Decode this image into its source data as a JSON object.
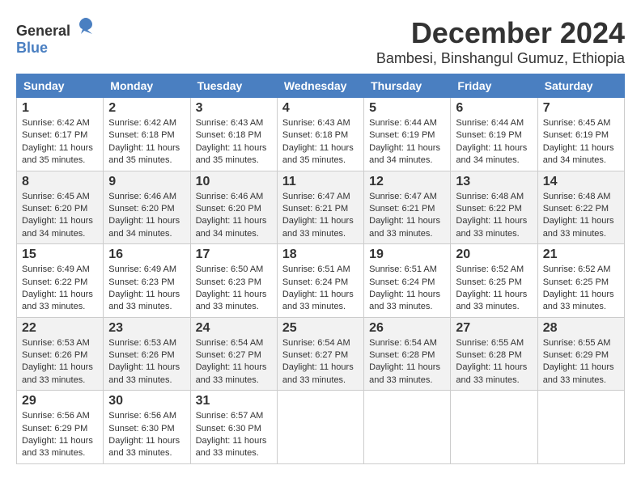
{
  "logo": {
    "general": "General",
    "blue": "Blue"
  },
  "title": "December 2024",
  "location": "Bambesi, Binshangul Gumuz, Ethiopia",
  "days_of_week": [
    "Sunday",
    "Monday",
    "Tuesday",
    "Wednesday",
    "Thursday",
    "Friday",
    "Saturday"
  ],
  "weeks": [
    [
      {
        "day": "1",
        "sunrise": "6:42 AM",
        "sunset": "6:17 PM",
        "daylight": "11 hours and 35 minutes."
      },
      {
        "day": "2",
        "sunrise": "6:42 AM",
        "sunset": "6:18 PM",
        "daylight": "11 hours and 35 minutes."
      },
      {
        "day": "3",
        "sunrise": "6:43 AM",
        "sunset": "6:18 PM",
        "daylight": "11 hours and 35 minutes."
      },
      {
        "day": "4",
        "sunrise": "6:43 AM",
        "sunset": "6:18 PM",
        "daylight": "11 hours and 35 minutes."
      },
      {
        "day": "5",
        "sunrise": "6:44 AM",
        "sunset": "6:19 PM",
        "daylight": "11 hours and 34 minutes."
      },
      {
        "day": "6",
        "sunrise": "6:44 AM",
        "sunset": "6:19 PM",
        "daylight": "11 hours and 34 minutes."
      },
      {
        "day": "7",
        "sunrise": "6:45 AM",
        "sunset": "6:19 PM",
        "daylight": "11 hours and 34 minutes."
      }
    ],
    [
      {
        "day": "8",
        "sunrise": "6:45 AM",
        "sunset": "6:20 PM",
        "daylight": "11 hours and 34 minutes."
      },
      {
        "day": "9",
        "sunrise": "6:46 AM",
        "sunset": "6:20 PM",
        "daylight": "11 hours and 34 minutes."
      },
      {
        "day": "10",
        "sunrise": "6:46 AM",
        "sunset": "6:20 PM",
        "daylight": "11 hours and 34 minutes."
      },
      {
        "day": "11",
        "sunrise": "6:47 AM",
        "sunset": "6:21 PM",
        "daylight": "11 hours and 33 minutes."
      },
      {
        "day": "12",
        "sunrise": "6:47 AM",
        "sunset": "6:21 PM",
        "daylight": "11 hours and 33 minutes."
      },
      {
        "day": "13",
        "sunrise": "6:48 AM",
        "sunset": "6:22 PM",
        "daylight": "11 hours and 33 minutes."
      },
      {
        "day": "14",
        "sunrise": "6:48 AM",
        "sunset": "6:22 PM",
        "daylight": "11 hours and 33 minutes."
      }
    ],
    [
      {
        "day": "15",
        "sunrise": "6:49 AM",
        "sunset": "6:22 PM",
        "daylight": "11 hours and 33 minutes."
      },
      {
        "day": "16",
        "sunrise": "6:49 AM",
        "sunset": "6:23 PM",
        "daylight": "11 hours and 33 minutes."
      },
      {
        "day": "17",
        "sunrise": "6:50 AM",
        "sunset": "6:23 PM",
        "daylight": "11 hours and 33 minutes."
      },
      {
        "day": "18",
        "sunrise": "6:51 AM",
        "sunset": "6:24 PM",
        "daylight": "11 hours and 33 minutes."
      },
      {
        "day": "19",
        "sunrise": "6:51 AM",
        "sunset": "6:24 PM",
        "daylight": "11 hours and 33 minutes."
      },
      {
        "day": "20",
        "sunrise": "6:52 AM",
        "sunset": "6:25 PM",
        "daylight": "11 hours and 33 minutes."
      },
      {
        "day": "21",
        "sunrise": "6:52 AM",
        "sunset": "6:25 PM",
        "daylight": "11 hours and 33 minutes."
      }
    ],
    [
      {
        "day": "22",
        "sunrise": "6:53 AM",
        "sunset": "6:26 PM",
        "daylight": "11 hours and 33 minutes."
      },
      {
        "day": "23",
        "sunrise": "6:53 AM",
        "sunset": "6:26 PM",
        "daylight": "11 hours and 33 minutes."
      },
      {
        "day": "24",
        "sunrise": "6:54 AM",
        "sunset": "6:27 PM",
        "daylight": "11 hours and 33 minutes."
      },
      {
        "day": "25",
        "sunrise": "6:54 AM",
        "sunset": "6:27 PM",
        "daylight": "11 hours and 33 minutes."
      },
      {
        "day": "26",
        "sunrise": "6:54 AM",
        "sunset": "6:28 PM",
        "daylight": "11 hours and 33 minutes."
      },
      {
        "day": "27",
        "sunrise": "6:55 AM",
        "sunset": "6:28 PM",
        "daylight": "11 hours and 33 minutes."
      },
      {
        "day": "28",
        "sunrise": "6:55 AM",
        "sunset": "6:29 PM",
        "daylight": "11 hours and 33 minutes."
      }
    ],
    [
      {
        "day": "29",
        "sunrise": "6:56 AM",
        "sunset": "6:29 PM",
        "daylight": "11 hours and 33 minutes."
      },
      {
        "day": "30",
        "sunrise": "6:56 AM",
        "sunset": "6:30 PM",
        "daylight": "11 hours and 33 minutes."
      },
      {
        "day": "31",
        "sunrise": "6:57 AM",
        "sunset": "6:30 PM",
        "daylight": "11 hours and 33 minutes."
      },
      null,
      null,
      null,
      null
    ]
  ]
}
